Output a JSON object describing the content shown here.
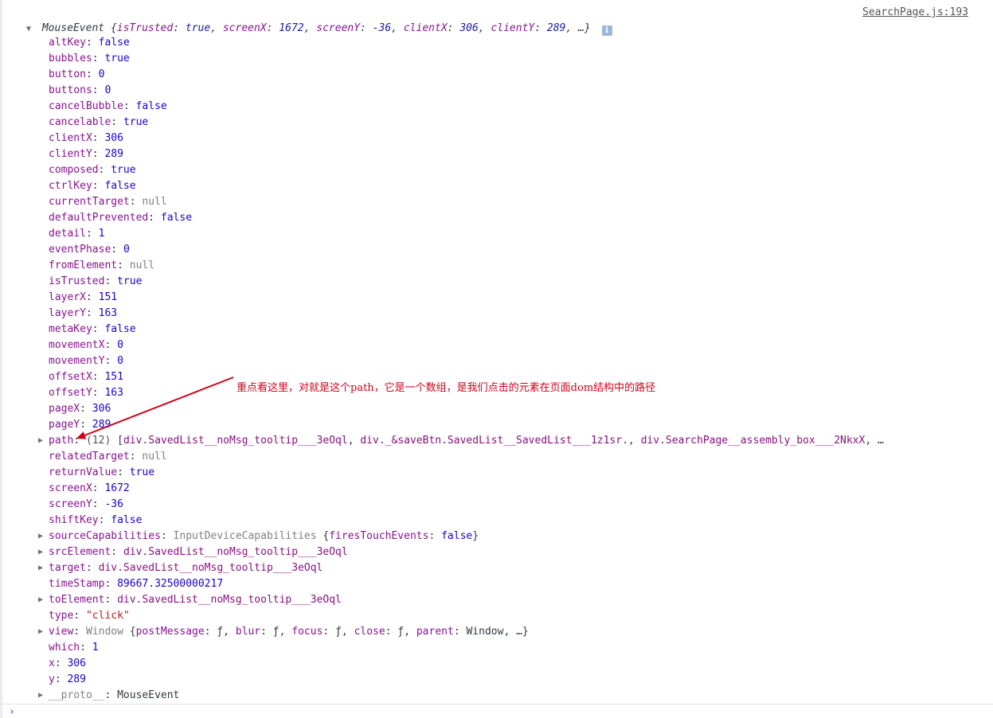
{
  "source_link": "SearchPage.js:193",
  "summary": {
    "class_name": "MouseEvent",
    "open_brace": "{",
    "pairs": [
      {
        "key": "isTrusted",
        "value": "true"
      },
      {
        "key": "screenX",
        "value": "1672"
      },
      {
        "key": "screenY",
        "value": "-36"
      },
      {
        "key": "clientX",
        "value": "306"
      },
      {
        "key": "clientY",
        "value": "289"
      }
    ],
    "ellipsis": "…}",
    "info_icon": "i"
  },
  "properties": [
    {
      "key": "altKey",
      "value": "false",
      "type": "bool",
      "expandable": false
    },
    {
      "key": "bubbles",
      "value": "true",
      "type": "bool",
      "expandable": false
    },
    {
      "key": "button",
      "value": "0",
      "type": "num",
      "expandable": false
    },
    {
      "key": "buttons",
      "value": "0",
      "type": "num",
      "expandable": false
    },
    {
      "key": "cancelBubble",
      "value": "false",
      "type": "bool",
      "expandable": false
    },
    {
      "key": "cancelable",
      "value": "true",
      "type": "bool",
      "expandable": false
    },
    {
      "key": "clientX",
      "value": "306",
      "type": "num",
      "expandable": false
    },
    {
      "key": "clientY",
      "value": "289",
      "type": "num",
      "expandable": false
    },
    {
      "key": "composed",
      "value": "true",
      "type": "bool",
      "expandable": false
    },
    {
      "key": "ctrlKey",
      "value": "false",
      "type": "bool",
      "expandable": false
    },
    {
      "key": "currentTarget",
      "value": "null",
      "type": "nul",
      "expandable": false
    },
    {
      "key": "defaultPrevented",
      "value": "false",
      "type": "bool",
      "expandable": false
    },
    {
      "key": "detail",
      "value": "1",
      "type": "num",
      "expandable": false
    },
    {
      "key": "eventPhase",
      "value": "0",
      "type": "num",
      "expandable": false
    },
    {
      "key": "fromElement",
      "value": "null",
      "type": "nul",
      "expandable": false
    },
    {
      "key": "isTrusted",
      "value": "true",
      "type": "bool",
      "expandable": false
    },
    {
      "key": "layerX",
      "value": "151",
      "type": "num",
      "expandable": false
    },
    {
      "key": "layerY",
      "value": "163",
      "type": "num",
      "expandable": false
    },
    {
      "key": "metaKey",
      "value": "false",
      "type": "bool",
      "expandable": false
    },
    {
      "key": "movementX",
      "value": "0",
      "type": "num",
      "expandable": false
    },
    {
      "key": "movementY",
      "value": "0",
      "type": "num",
      "expandable": false
    },
    {
      "key": "offsetX",
      "value": "151",
      "type": "num",
      "expandable": false
    },
    {
      "key": "offsetY",
      "value": "163",
      "type": "num",
      "expandable": false
    },
    {
      "key": "pageX",
      "value": "306",
      "type": "num",
      "expandable": false
    },
    {
      "key": "pageY",
      "value": "289",
      "type": "num",
      "expandable": false
    },
    {
      "key": "path",
      "type": "array",
      "expandable": true,
      "count": "(12)",
      "items": [
        "div.SavedList__noMsg_tooltip___3eOql",
        "div._&saveBtn.SavedList__SavedList___1z1sr.",
        "div.SearchPage__assembly_box___2NkxX"
      ],
      "ellipsis": "…"
    },
    {
      "key": "relatedTarget",
      "value": "null",
      "type": "nul",
      "expandable": false
    },
    {
      "key": "returnValue",
      "value": "true",
      "type": "bool",
      "expandable": false
    },
    {
      "key": "screenX",
      "value": "1672",
      "type": "num",
      "expandable": false
    },
    {
      "key": "screenY",
      "value": "-36",
      "type": "num",
      "expandable": false
    },
    {
      "key": "shiftKey",
      "value": "false",
      "type": "bool",
      "expandable": false
    },
    {
      "key": "sourceCapabilities",
      "type": "object",
      "expandable": true,
      "cls": "InputDeviceCapabilities",
      "preview": [
        {
          "key": "firesTouchEvents",
          "value": "false",
          "type": "bool"
        }
      ]
    },
    {
      "key": "srcElement",
      "value": "div.SavedList__noMsg_tooltip___3eOql",
      "type": "node",
      "expandable": true
    },
    {
      "key": "target",
      "value": "div.SavedList__noMsg_tooltip___3eOql",
      "type": "node",
      "expandable": true
    },
    {
      "key": "timeStamp",
      "value": "89667.32500000217",
      "type": "num",
      "expandable": false
    },
    {
      "key": "toElement",
      "value": "div.SavedList__noMsg_tooltip___3eOql",
      "type": "node",
      "expandable": true
    },
    {
      "key": "type",
      "value": "\"click\"",
      "type": "str",
      "expandable": false
    },
    {
      "key": "view",
      "type": "object",
      "expandable": true,
      "cls": "Window",
      "preview": [
        {
          "key": "postMessage",
          "value": "ƒ",
          "type": "fn"
        },
        {
          "key": "blur",
          "value": "ƒ",
          "type": "fn"
        },
        {
          "key": "focus",
          "value": "ƒ",
          "type": "fn"
        },
        {
          "key": "close",
          "value": "ƒ",
          "type": "fn"
        },
        {
          "key": "parent",
          "value": "Window",
          "type": "fn"
        }
      ],
      "ellipsis": "…"
    },
    {
      "key": "which",
      "value": "1",
      "type": "num",
      "expandable": false
    },
    {
      "key": "x",
      "value": "306",
      "type": "num",
      "expandable": false
    },
    {
      "key": "y",
      "value": "289",
      "type": "num",
      "expandable": false
    },
    {
      "key": "__proto__",
      "value": "MouseEvent",
      "type": "obj",
      "expandable": true,
      "proto": true
    }
  ],
  "annotation": {
    "text": "重点看这里，对就是这个path，它是一个数组，是我们点击的元素在页面dom结构中的路径",
    "color": "#d0021b"
  },
  "prompt": {
    "caret": "›"
  },
  "colors": {
    "key": "#881391",
    "bool_num": "#1c00cf",
    "null": "#808080",
    "string": "#c41a16",
    "node": "#881280",
    "annotation": "#d0021b",
    "prompt": "#367cf1"
  },
  "icons": {
    "expand": "triangle-right-icon",
    "collapse": "triangle-down-icon",
    "info": "info-icon",
    "prompt": "chevron-right-icon"
  }
}
